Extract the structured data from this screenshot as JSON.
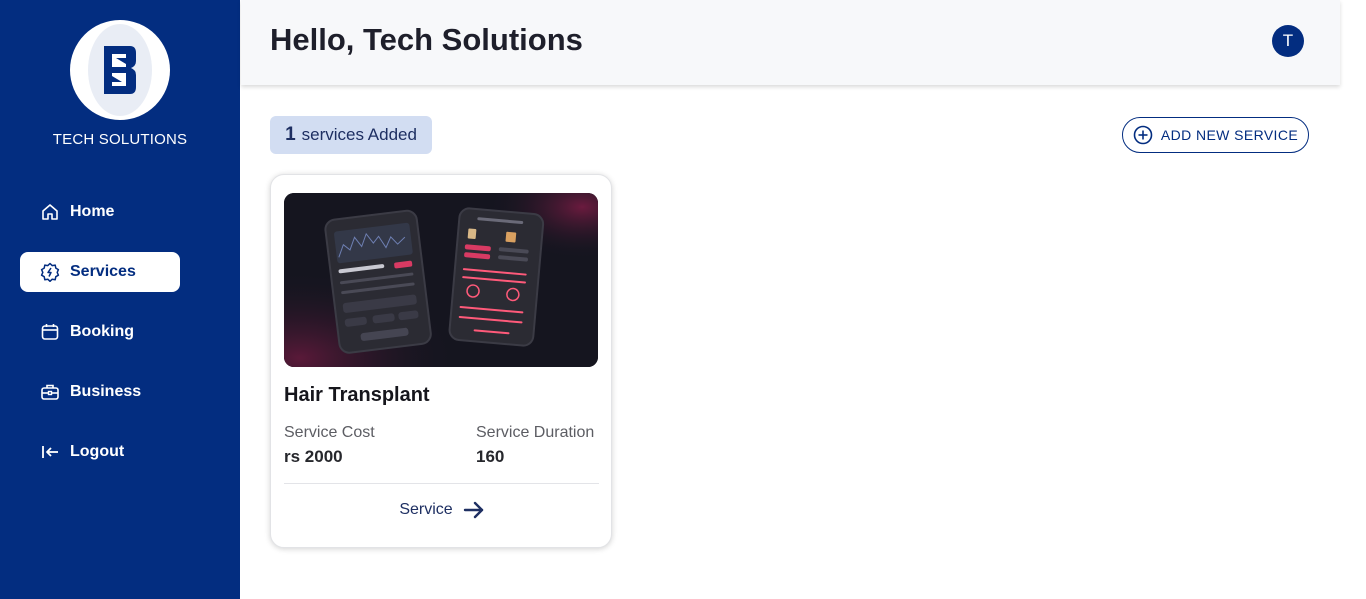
{
  "brand": {
    "name": "TECH SOLUTIONS",
    "logo_letter": "B"
  },
  "sidebar": {
    "items": [
      {
        "label": "Home",
        "icon": "home-icon",
        "active": false
      },
      {
        "label": "Services",
        "icon": "gear-icon",
        "active": true
      },
      {
        "label": "Booking",
        "icon": "calendar-icon",
        "active": false
      },
      {
        "label": "Business",
        "icon": "briefcase-icon",
        "active": false
      },
      {
        "label": "Logout",
        "icon": "logout-icon",
        "active": false
      }
    ]
  },
  "header": {
    "greeting": "Hello, Tech Solutions",
    "avatar_initial": "T"
  },
  "summary": {
    "count": "1",
    "count_label": "services Added"
  },
  "actions": {
    "add_service_label": "ADD NEW SERVICE"
  },
  "services": [
    {
      "title": "Hair Transplant",
      "cost_label": "Service Cost",
      "cost_value": "rs 2000",
      "duration_label": "Service Duration",
      "duration_value": "160",
      "link_label": "Service"
    }
  ],
  "colors": {
    "sidebar_bg": "#032d80",
    "accent": "#032d80",
    "badge_bg": "#d2ddf2",
    "header_bg": "#f7f8fa"
  }
}
